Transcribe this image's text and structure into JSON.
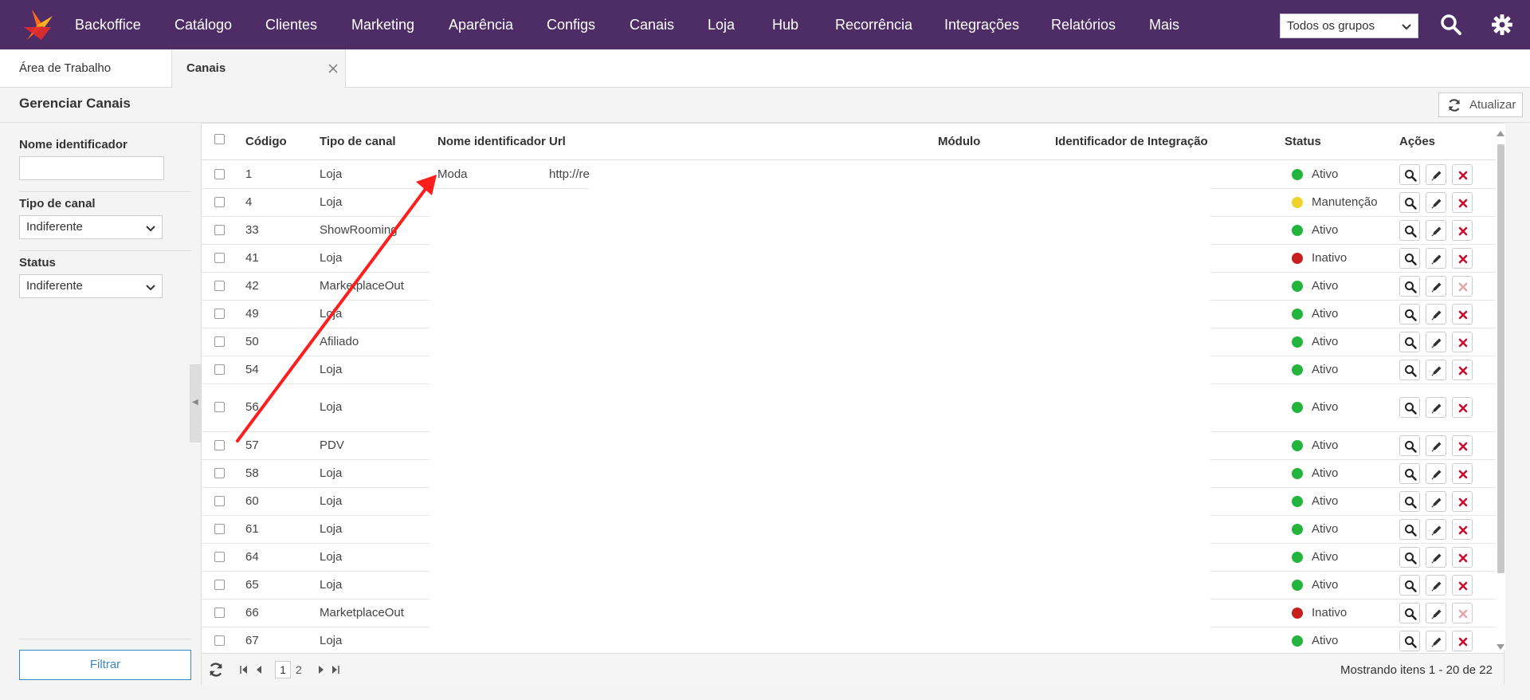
{
  "nav": {
    "brand": "Backoffice",
    "items": [
      "Catálogo",
      "Clientes",
      "Marketing",
      "Aparência",
      "Configs",
      "Canais",
      "Loja",
      "Hub",
      "Recorrência",
      "Integrações",
      "Relatórios",
      "Mais"
    ],
    "group_select": "Todos os grupos"
  },
  "tabs": [
    "Área de Trabalho",
    "Canais"
  ],
  "page": {
    "title": "Gerenciar Canais",
    "refresh_label": "Atualizar"
  },
  "filters": {
    "name_label": "Nome identificador",
    "name_value": "",
    "type_label": "Tipo de canal",
    "type_value": "Indiferente",
    "status_label": "Status",
    "status_value": "Indiferente",
    "button": "Filtrar"
  },
  "grid": {
    "columns": [
      "Código",
      "Tipo de canal",
      "Nome identificador",
      "Url",
      "Módulo",
      "Identificador de Integração",
      "Status",
      "Ações"
    ],
    "rows": [
      {
        "code": "1",
        "type": "Loja",
        "name": "Moda",
        "url": "http://re",
        "status": "Ativo",
        "status_color": "#22b43c"
      },
      {
        "code": "4",
        "type": "Loja",
        "name": "",
        "url": "",
        "status": "Manutenção",
        "status_color": "#f0d22d"
      },
      {
        "code": "33",
        "type": "ShowRooming",
        "name": "",
        "url": "",
        "status": "Ativo",
        "status_color": "#22b43c"
      },
      {
        "code": "41",
        "type": "Loja",
        "name": "",
        "url": "",
        "status": "Inativo",
        "status_color": "#c81e1e"
      },
      {
        "code": "42",
        "type": "MarketplaceOut",
        "name": "",
        "url": "",
        "status": "Ativo",
        "status_color": "#22b43c"
      },
      {
        "code": "49",
        "type": "Loja",
        "name": "",
        "url": "",
        "status": "Ativo",
        "status_color": "#22b43c"
      },
      {
        "code": "50",
        "type": "Afiliado",
        "name": "",
        "url": "",
        "status": "Ativo",
        "status_color": "#22b43c"
      },
      {
        "code": "54",
        "type": "Loja",
        "name": "",
        "url": "",
        "status": "Ativo",
        "status_color": "#22b43c"
      },
      {
        "code": "56",
        "type": "Loja",
        "name": "",
        "url": "",
        "status": "Ativo",
        "status_color": "#22b43c"
      },
      {
        "code": "57",
        "type": "PDV",
        "name": "",
        "url": "",
        "status": "Ativo",
        "status_color": "#22b43c"
      },
      {
        "code": "58",
        "type": "Loja",
        "name": "",
        "url": "",
        "status": "Ativo",
        "status_color": "#22b43c"
      },
      {
        "code": "60",
        "type": "Loja",
        "name": "",
        "url": "",
        "status": "Ativo",
        "status_color": "#22b43c"
      },
      {
        "code": "61",
        "type": "Loja",
        "name": "",
        "url": "",
        "status": "Ativo",
        "status_color": "#22b43c"
      },
      {
        "code": "64",
        "type": "Loja",
        "name": "",
        "url": "",
        "status": "Ativo",
        "status_color": "#22b43c"
      },
      {
        "code": "65",
        "type": "Loja",
        "name": "",
        "url": "",
        "status": "Ativo",
        "status_color": "#22b43c"
      },
      {
        "code": "66",
        "type": "MarketplaceOut",
        "name": "",
        "url": "",
        "status": "Inativo",
        "status_color": "#c81e1e"
      },
      {
        "code": "67",
        "type": "Loja",
        "name": "",
        "url": "",
        "status": "Ativo",
        "status_color": "#22b43c"
      }
    ]
  },
  "pager": {
    "current": "1",
    "next": "2",
    "info": "Mostrando itens 1 - 20 de 22"
  },
  "colors": {
    "nav_bg": "#4e2d67",
    "accent": "#3a87c8",
    "delete": "#c8102e",
    "annotation_arrow": "#ff1e1e"
  }
}
